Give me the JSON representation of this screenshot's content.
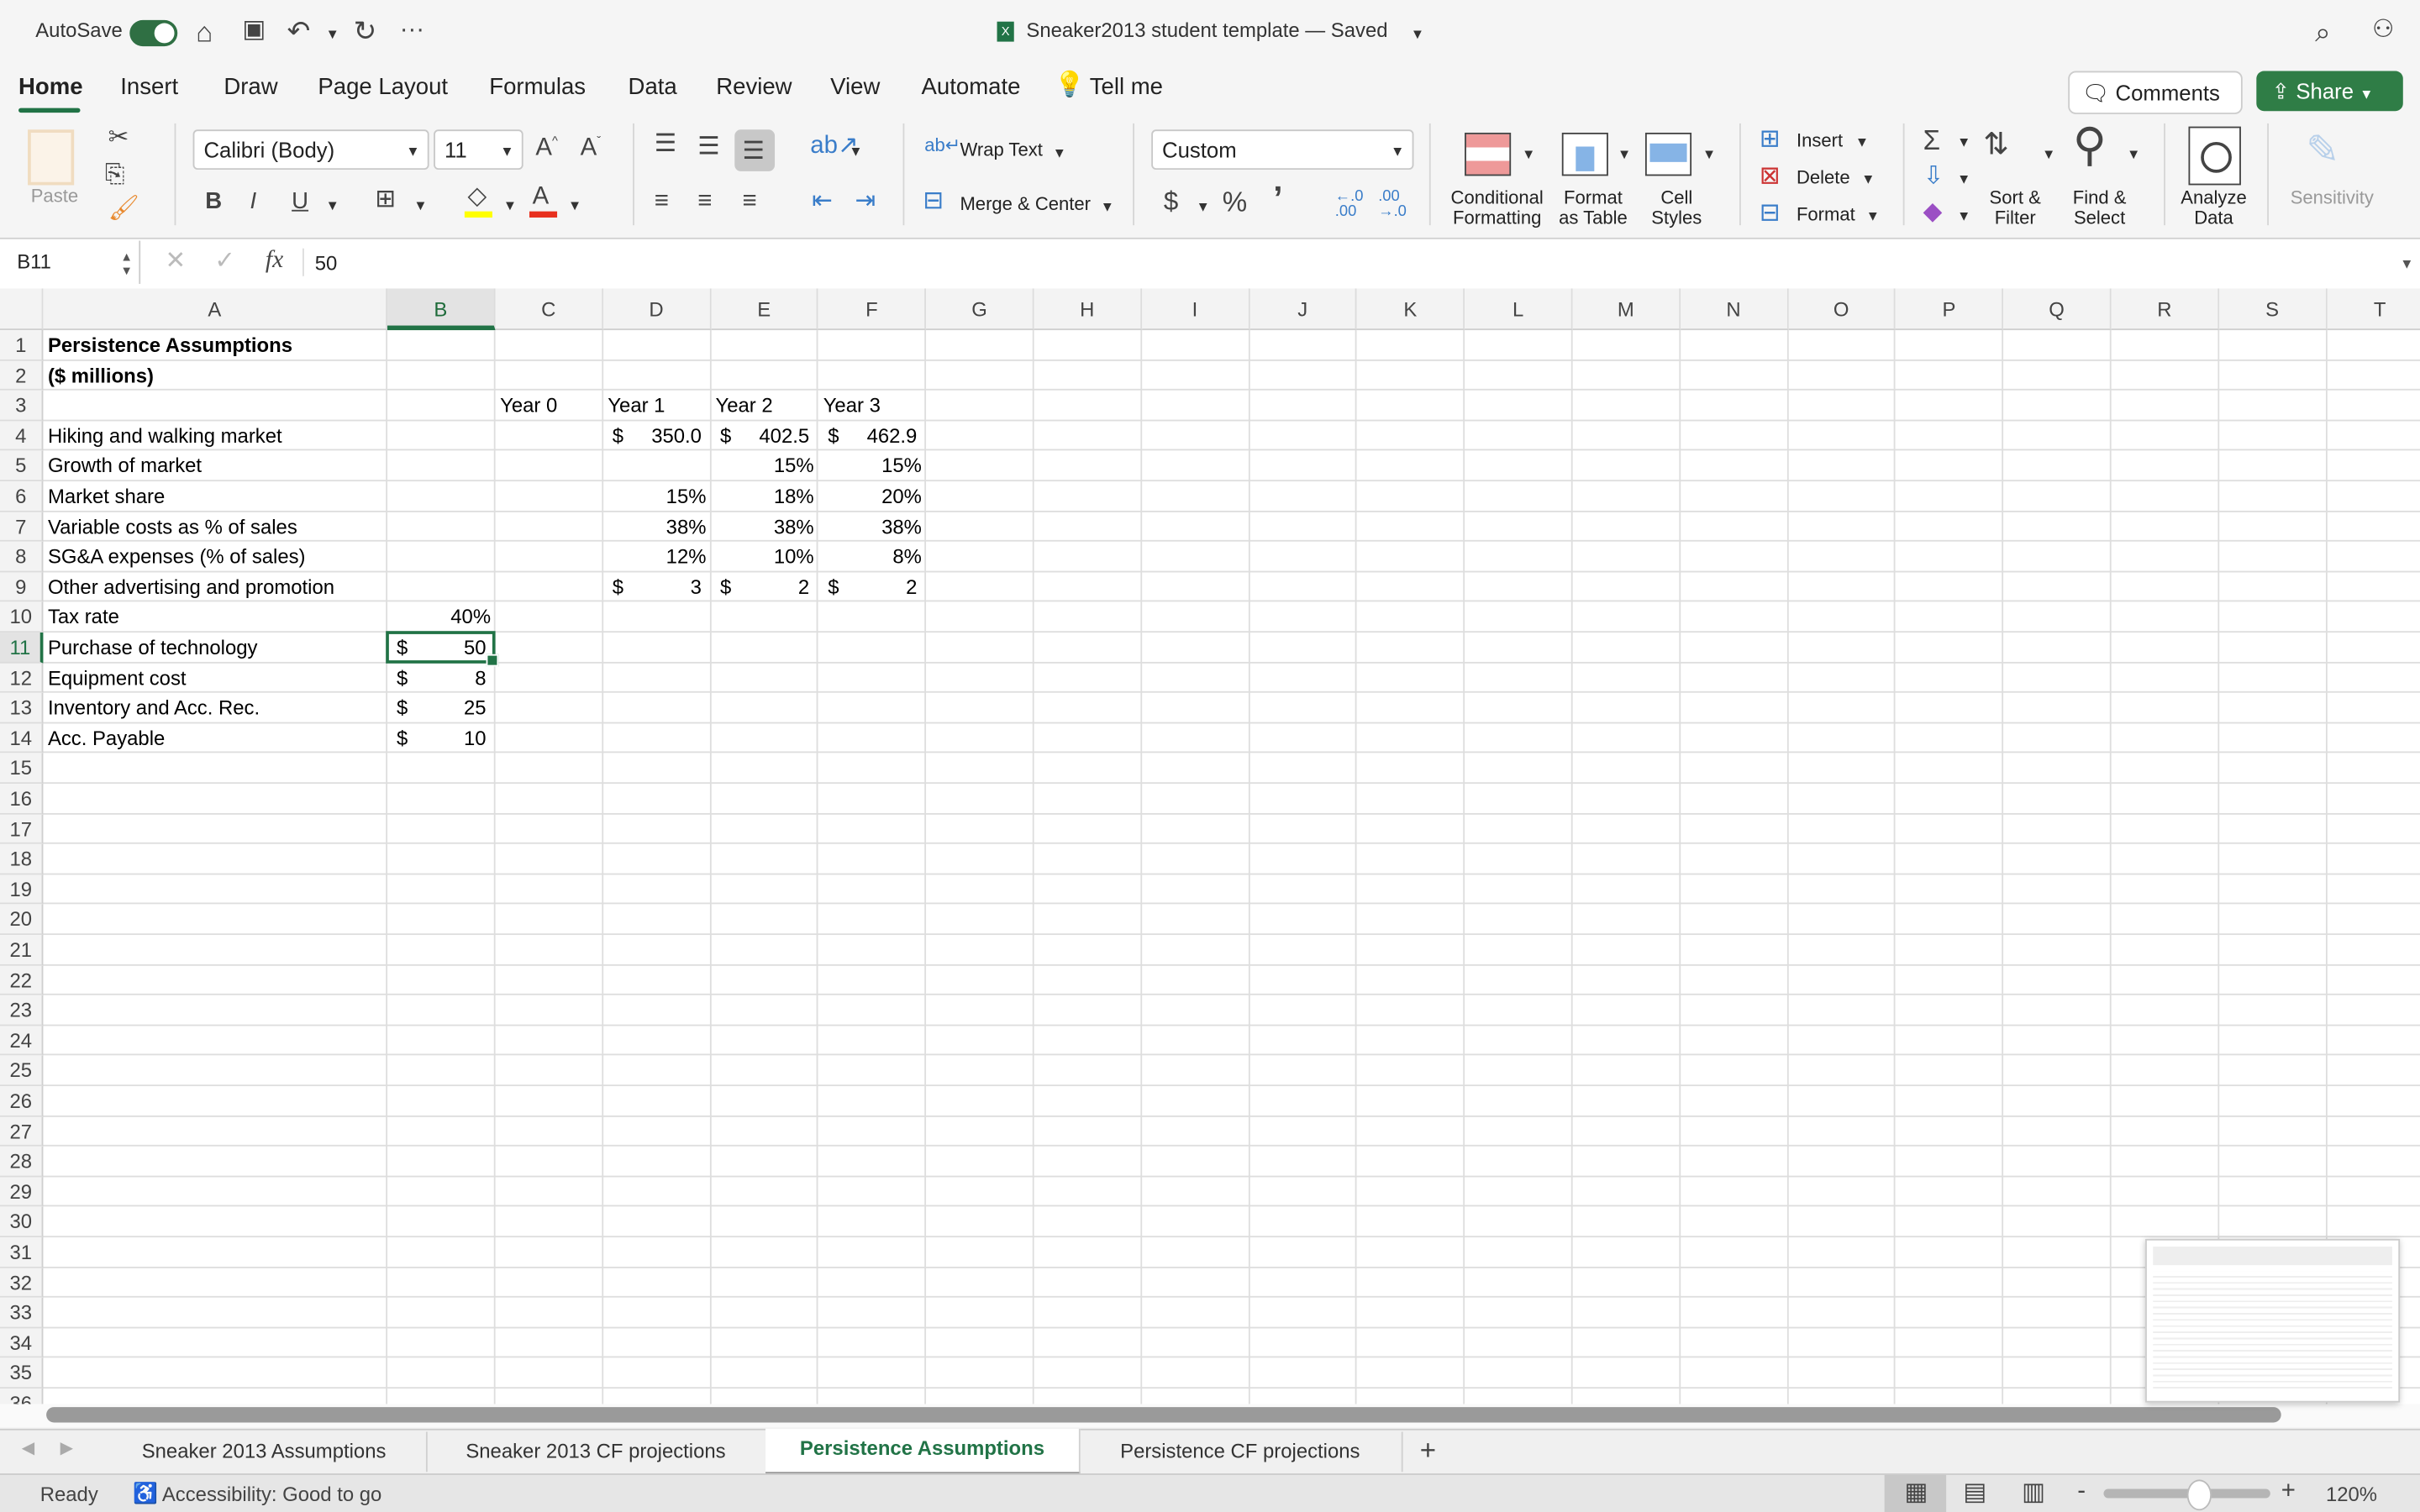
{
  "titlebar": {
    "autosave_label": "AutoSave",
    "autosave_on": true,
    "doc_title": "Sneaker2013 student template — Saved",
    "icons": [
      "home-icon",
      "save-icon",
      "undo-icon",
      "redo-icon",
      "more-icon",
      "search-icon",
      "share-person-icon"
    ]
  },
  "menu": {
    "tabs": [
      "Home",
      "Insert",
      "Draw",
      "Page Layout",
      "Formulas",
      "Data",
      "Review",
      "View",
      "Automate"
    ],
    "active": "Home",
    "tell_me": "Tell me",
    "comments": "Comments",
    "share": "Share"
  },
  "ribbon": {
    "paste": "Paste",
    "font_name": "Calibri (Body)",
    "font_size": "11",
    "bold": "B",
    "italic": "I",
    "underline": "U",
    "wrap_text": "Wrap Text",
    "merge_center": "Merge & Center",
    "number_format": "Custom",
    "currency": "$",
    "percent": "%",
    "comma": "’",
    "conditional_formatting": [
      "Conditional",
      "Formatting"
    ],
    "format_as_table": [
      "Format",
      "as Table"
    ],
    "cell_styles": [
      "Cell",
      "Styles"
    ],
    "insert": "Insert",
    "delete": "Delete",
    "format": "Format",
    "sort_filter": [
      "Sort &",
      "Filter"
    ],
    "find_select": [
      "Find &",
      "Select"
    ],
    "analyze_data": [
      "Analyze",
      "Data"
    ],
    "sensitivity": "Sensitivity",
    "colors": {
      "highlight": "#ffff00",
      "font_color": "#e8301e"
    }
  },
  "formula_bar": {
    "name_box": "B11",
    "fx": "fx",
    "value": "50"
  },
  "grid": {
    "columns": [
      "A",
      "B",
      "C",
      "D",
      "E",
      "F",
      "G",
      "H",
      "I",
      "J",
      "K",
      "L",
      "M",
      "N",
      "O",
      "P",
      "Q",
      "R",
      "S",
      "T"
    ],
    "selected_column": "B",
    "selected_row": 11,
    "row_count": 36,
    "rows": [
      {
        "r": 1,
        "cells": {
          "A": {
            "v": "Persistence Assumptions",
            "bold": true
          }
        }
      },
      {
        "r": 2,
        "cells": {
          "A": {
            "v": "($ millions)",
            "bold": true
          }
        }
      },
      {
        "r": 3,
        "cells": {
          "C": {
            "v": "Year 0"
          },
          "D": {
            "v": "Year 1"
          },
          "E": {
            "v": "Year 2"
          },
          "F": {
            "v": "Year 3"
          }
        }
      },
      {
        "r": 4,
        "cells": {
          "A": {
            "v": "Hiking and walking market"
          },
          "D": {
            "cur": "$",
            "v": "350.0"
          },
          "E": {
            "cur": "$",
            "v": "402.5"
          },
          "F": {
            "cur": "$",
            "v": "462.9"
          }
        }
      },
      {
        "r": 5,
        "cells": {
          "A": {
            "v": "Growth of market"
          },
          "E": {
            "v": "15%",
            "right": true
          },
          "F": {
            "v": "15%",
            "right": true
          }
        }
      },
      {
        "r": 6,
        "cells": {
          "A": {
            "v": "Market share"
          },
          "D": {
            "v": "15%",
            "right": true
          },
          "E": {
            "v": "18%",
            "right": true
          },
          "F": {
            "v": "20%",
            "right": true
          }
        }
      },
      {
        "r": 7,
        "cells": {
          "A": {
            "v": "Variable costs as % of sales"
          },
          "D": {
            "v": "38%",
            "right": true
          },
          "E": {
            "v": "38%",
            "right": true
          },
          "F": {
            "v": "38%",
            "right": true
          }
        }
      },
      {
        "r": 8,
        "cells": {
          "A": {
            "v": "SG&A expenses (% of sales)"
          },
          "D": {
            "v": "12%",
            "right": true
          },
          "E": {
            "v": "10%",
            "right": true
          },
          "F": {
            "v": "8%",
            "right": true
          }
        }
      },
      {
        "r": 9,
        "cells": {
          "A": {
            "v": "Other advertising and promotion"
          },
          "D": {
            "cur": "$",
            "v": "3"
          },
          "E": {
            "cur": "$",
            "v": "2"
          },
          "F": {
            "cur": "$",
            "v": "2"
          }
        }
      },
      {
        "r": 10,
        "cells": {
          "A": {
            "v": "Tax rate"
          },
          "B": {
            "v": "40%",
            "right": true
          }
        }
      },
      {
        "r": 11,
        "cells": {
          "A": {
            "v": "Purchase of technology"
          },
          "B": {
            "cur": "$",
            "v": "50"
          }
        }
      },
      {
        "r": 12,
        "cells": {
          "A": {
            "v": "Equipment cost"
          },
          "B": {
            "cur": "$",
            "v": "8"
          }
        }
      },
      {
        "r": 13,
        "cells": {
          "A": {
            "v": "Inventory and Acc. Rec."
          },
          "B": {
            "cur": "$",
            "v": "25"
          }
        }
      },
      {
        "r": 14,
        "cells": {
          "A": {
            "v": "Acc. Payable"
          },
          "B": {
            "cur": "$",
            "v": "10"
          }
        }
      }
    ]
  },
  "sheet_tabs": [
    "Sneaker 2013 Assumptions",
    "Sneaker 2013 CF projections",
    "Persistence Assumptions",
    "Persistence CF projections"
  ],
  "active_sheet": "Persistence Assumptions",
  "status_bar": {
    "ready": "Ready",
    "accessibility": "Accessibility: Good to go",
    "zoom": "120%",
    "zoom_percent": 120
  },
  "accent": "#217346"
}
